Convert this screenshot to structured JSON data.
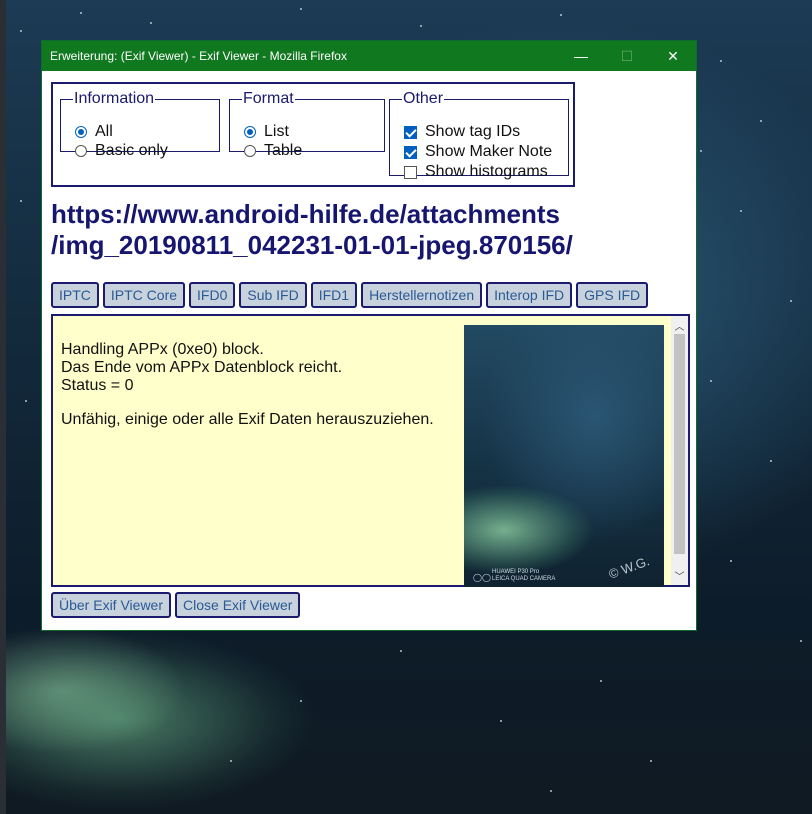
{
  "window": {
    "title": "Erweiterung: (Exif Viewer) - Exif Viewer - Mozilla Firefox",
    "minimize": "—",
    "maximize": "☐",
    "close": "✕"
  },
  "information": {
    "legend": "Information",
    "options": [
      {
        "label": "All",
        "checked": true
      },
      {
        "label": "Basic only",
        "checked": false
      }
    ]
  },
  "format": {
    "legend": "Format",
    "options": [
      {
        "label": "List",
        "checked": true
      },
      {
        "label": "Table",
        "checked": false
      }
    ]
  },
  "other": {
    "legend": "Other",
    "options": [
      {
        "label": "Show tag IDs",
        "checked": true
      },
      {
        "label": "Show Maker Note",
        "checked": true
      },
      {
        "label": "Show histograms",
        "checked": false
      }
    ]
  },
  "url": {
    "line1": "https://www.android-hilfe.de/attachments",
    "line2": "/img_20190811_042231-01-01-jpeg.870156/"
  },
  "tabs": [
    "IPTC",
    "IPTC Core",
    "IFD0",
    "Sub IFD",
    "IFD1",
    "Herstellernotizen",
    "Interop IFD",
    "GPS IFD"
  ],
  "content": {
    "lines": [
      "Handling APPx (0xe0) block.",
      "Das Ende vom APPx Datenblock reicht.",
      "Status = 0"
    ],
    "error": "Unfähig, einige oder alle Exif Daten herauszuziehen."
  },
  "photo": {
    "caption1": "HUAWEI P30 Pro",
    "caption2": "LEICA QUAD CAMERA",
    "watermark": "© W.G."
  },
  "buttons": {
    "about": "Über Exif Viewer",
    "close": "Close Exif Viewer"
  }
}
